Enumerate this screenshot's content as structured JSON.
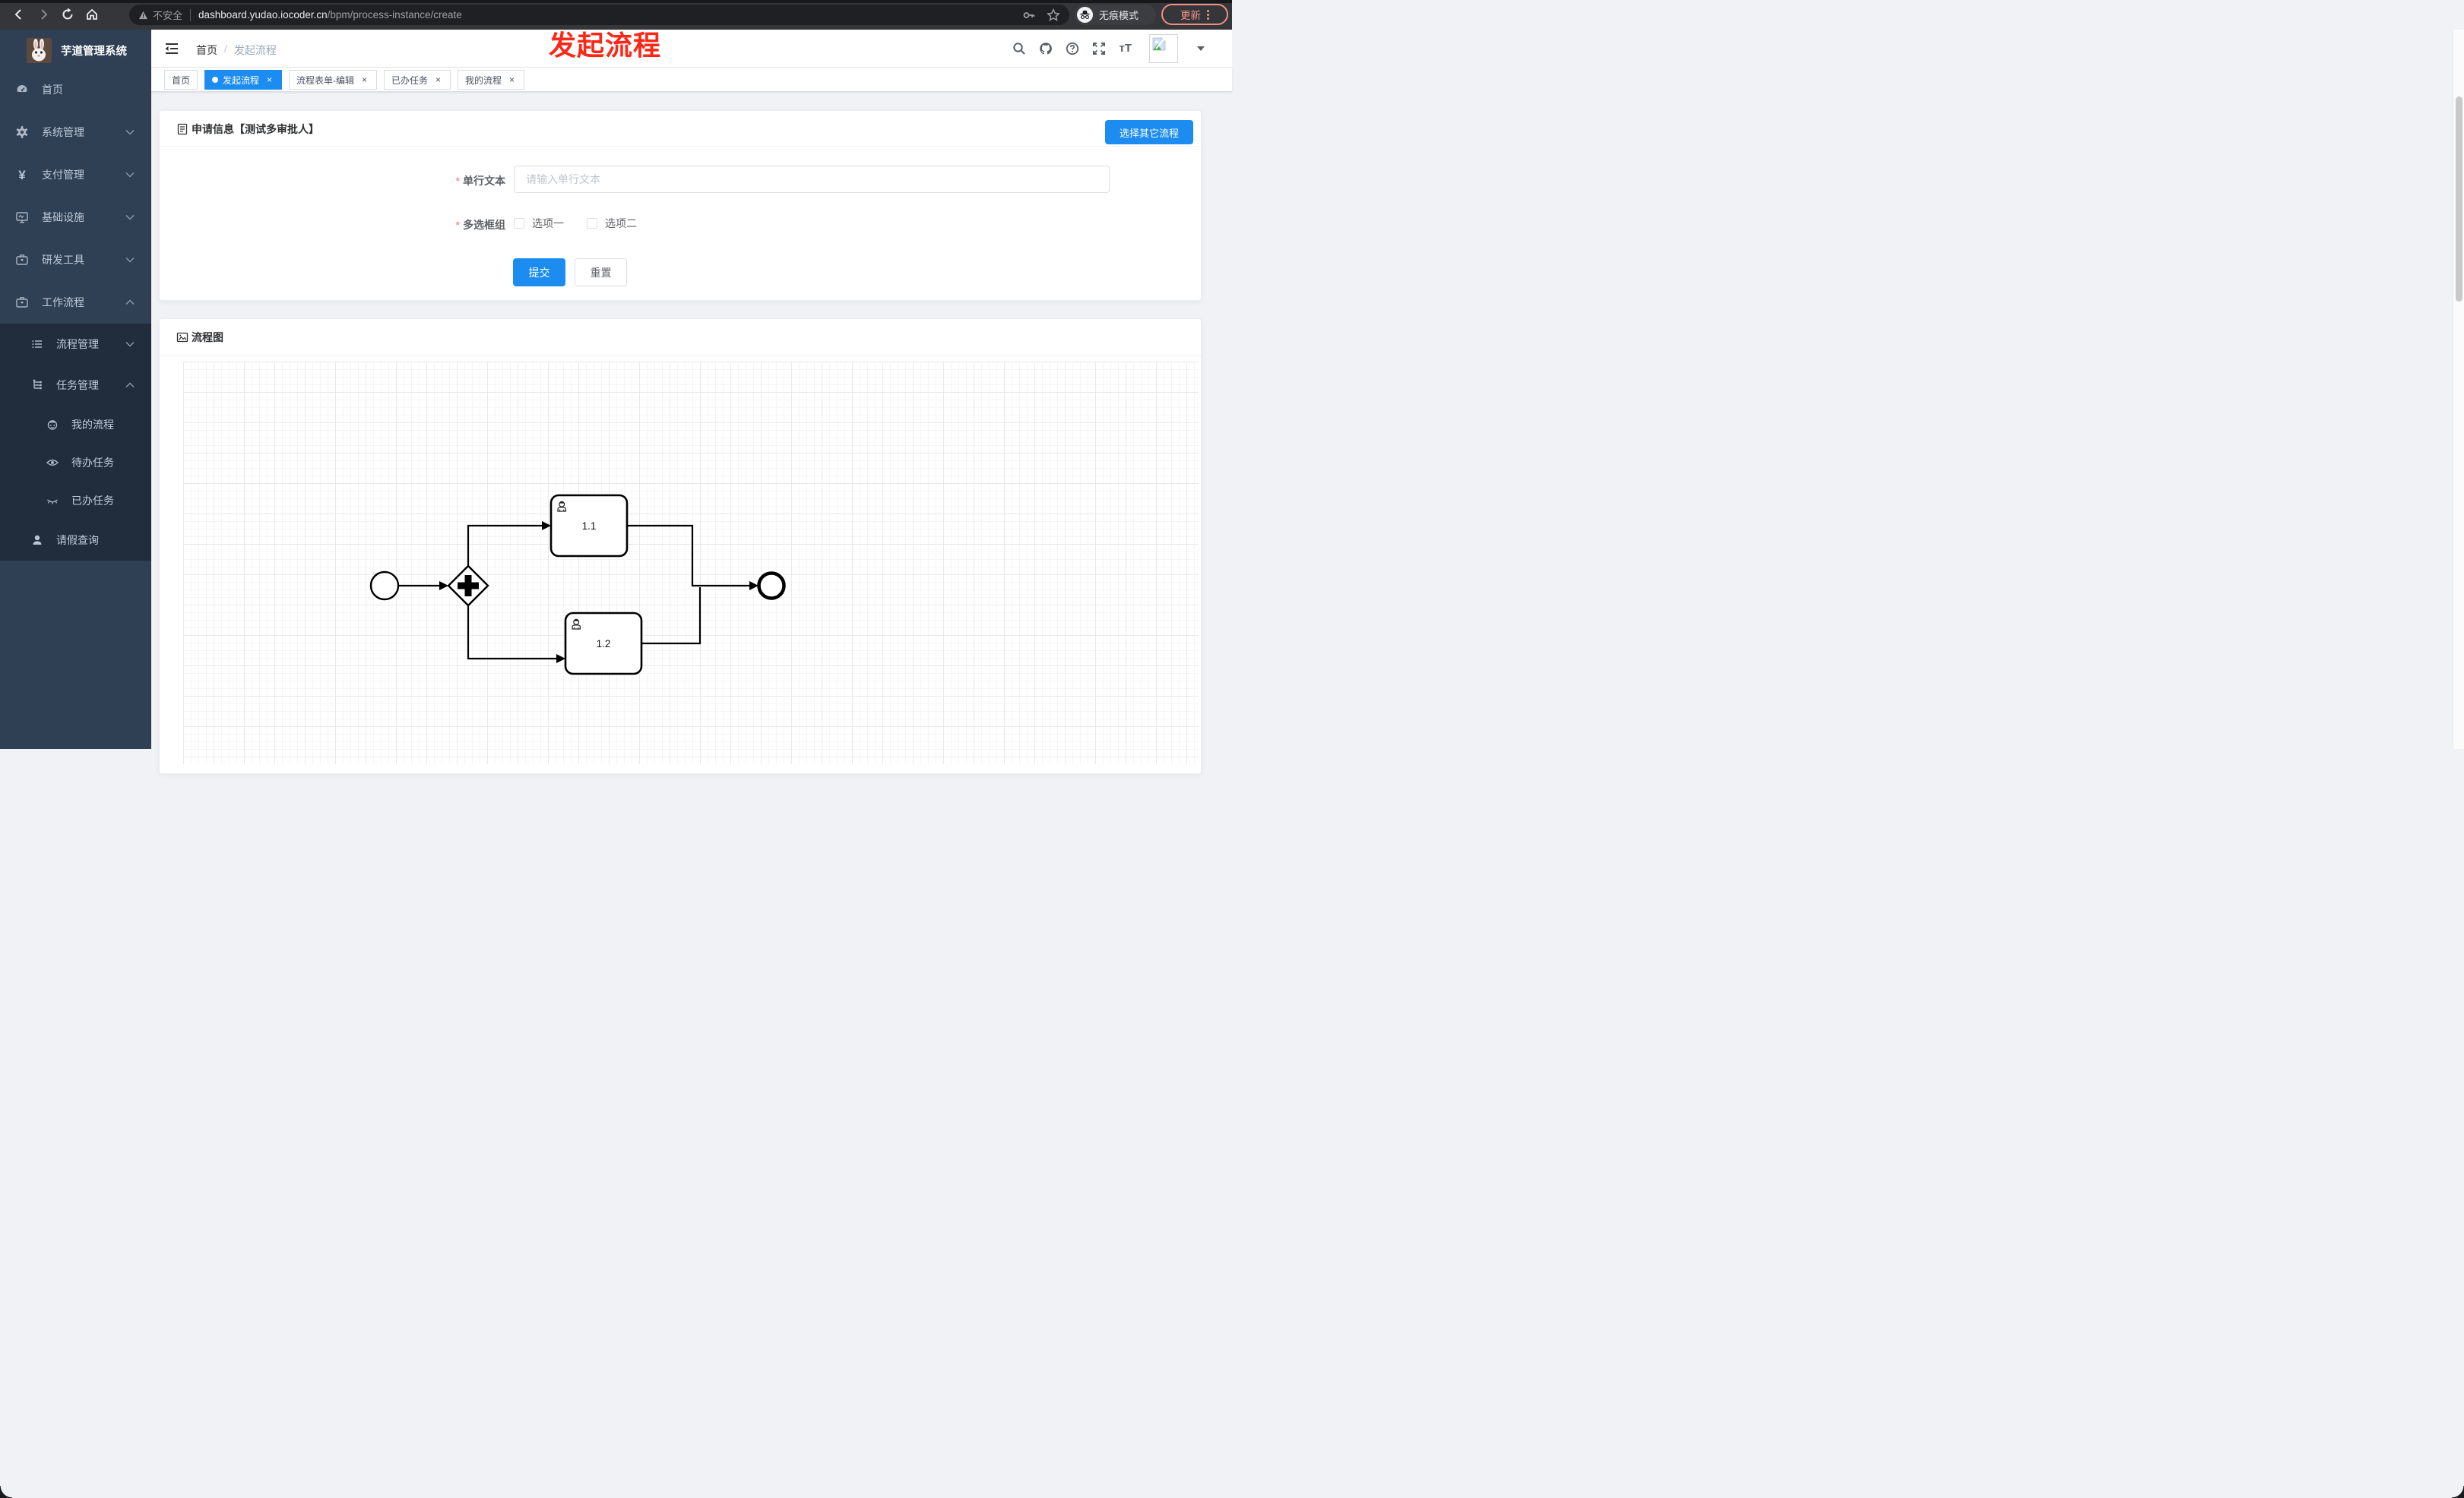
{
  "browser": {
    "security_label": "不安全",
    "url_host": "dashboard.yudao.iocoder.cn",
    "url_path": "/bpm/process-instance/create",
    "incognito_label": "无痕模式",
    "update_label": "更新"
  },
  "annotation": {
    "text": "发起流程"
  },
  "sidebar": {
    "title": "芋道管理系统",
    "items": [
      {
        "label": "首页",
        "icon": "dashboard-icon",
        "level": 1
      },
      {
        "label": "系统管理",
        "icon": "gear-icon",
        "level": 1,
        "arrow": "down"
      },
      {
        "label": "支付管理",
        "icon": "yen-icon",
        "level": 1,
        "arrow": "down"
      },
      {
        "label": "基础设施",
        "icon": "monitor-icon",
        "level": 1,
        "arrow": "down"
      },
      {
        "label": "研发工具",
        "icon": "briefcase-icon",
        "level": 1,
        "arrow": "down"
      },
      {
        "label": "工作流程",
        "icon": "briefcase-icon",
        "level": 1,
        "arrow": "up"
      },
      {
        "label": "流程管理",
        "icon": "list-icon",
        "level": 2,
        "arrow": "down"
      },
      {
        "label": "任务管理",
        "icon": "tree-icon",
        "level": 2,
        "arrow": "up"
      },
      {
        "label": "我的流程",
        "icon": "face-icon",
        "level": 3
      },
      {
        "label": "待办任务",
        "icon": "eye-icon",
        "level": 3
      },
      {
        "label": "已办任务",
        "icon": "eye-closed-icon",
        "level": 3
      },
      {
        "label": "请假查询",
        "icon": "user-icon",
        "level": 2
      }
    ]
  },
  "header": {
    "breadcrumb_home": "首页",
    "breadcrumb_current": "发起流程"
  },
  "tabs": [
    {
      "label": "首页",
      "active": false,
      "closable": false
    },
    {
      "label": "发起流程",
      "active": true,
      "closable": true
    },
    {
      "label": "流程表单-编辑",
      "active": false,
      "closable": true
    },
    {
      "label": "已办任务",
      "active": false,
      "closable": true
    },
    {
      "label": "我的流程",
      "active": false,
      "closable": true
    }
  ],
  "form_card": {
    "title": "申请信息【测试多审批人】",
    "select_other_button": "选择其它流程",
    "field_text": {
      "label": "单行文本",
      "required": true,
      "value": "",
      "placeholder": "请输入单行文本"
    },
    "field_checkbox": {
      "label": "多选框组",
      "required": true,
      "option1": "选项一",
      "option2": "选项二",
      "option1_checked": false,
      "option2_checked": false
    },
    "submit_label": "提交",
    "reset_label": "重置"
  },
  "diagram_card": {
    "title": "流程图",
    "type": "bpmn",
    "task1_label": "1.1",
    "task2_label": "1.2"
  },
  "icons": {
    "close": "×",
    "slash": "/",
    "dots": "⋮",
    "asterisk": "*",
    "font_size_glyph": "тT"
  },
  "colors": {
    "accent_blue": "#1d8cf0",
    "sidebar_bg": "#2f3f54",
    "sidebar_submenu_bg": "#212d3d",
    "sidebar_text": "#bfcbd9",
    "danger_red": "#f56c6c",
    "annotation_red": "#fb2817",
    "chrome_update_red": "#ef8e85"
  }
}
